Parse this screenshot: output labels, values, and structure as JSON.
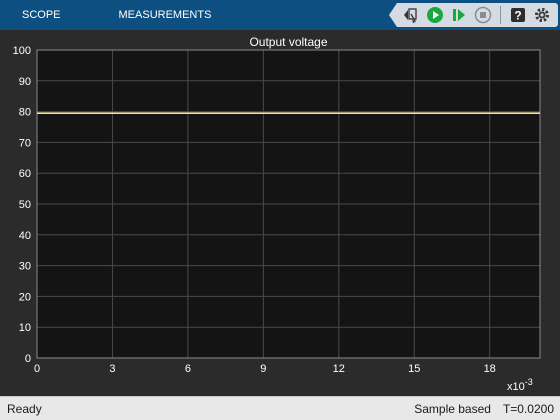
{
  "toolstrip": {
    "tabs": [
      {
        "label": "SCOPE"
      },
      {
        "label": "MEASUREMENTS"
      }
    ],
    "tools": [
      {
        "name": "signal-select-icon"
      },
      {
        "name": "run-icon"
      },
      {
        "name": "step-forward-icon"
      },
      {
        "name": "stop-icon"
      },
      {
        "name": "help-icon"
      },
      {
        "name": "settings-icon"
      }
    ]
  },
  "chart_data": {
    "type": "line",
    "title": "Output voltage",
    "xlabel": "",
    "ylabel": "",
    "xlim": [
      0,
      0.02
    ],
    "ylim": [
      0,
      100
    ],
    "x_ticks": [
      0,
      0.003,
      0.006,
      0.009,
      0.012,
      0.015,
      0.018
    ],
    "x_tick_labels": [
      "0",
      "3",
      "6",
      "9",
      "12",
      "15",
      "18"
    ],
    "x_exponent_label": "x10",
    "x_exponent": "-3",
    "y_ticks": [
      0,
      10,
      20,
      30,
      40,
      50,
      60,
      70,
      80,
      90,
      100
    ],
    "y_tick_labels": [
      "0",
      "10",
      "20",
      "30",
      "40",
      "50",
      "60",
      "70",
      "80",
      "90",
      "100"
    ],
    "grid": true,
    "series": [
      {
        "color": "#f2e29a",
        "x": [
          0,
          0.02
        ],
        "values": [
          79.5,
          79.5
        ]
      }
    ],
    "colors": {
      "background": "#141414",
      "grid": "#4a4a4a",
      "axis_text": "#ffffff"
    }
  },
  "status": {
    "left": "Ready",
    "mode": "Sample based",
    "time": "T=0.0200"
  }
}
